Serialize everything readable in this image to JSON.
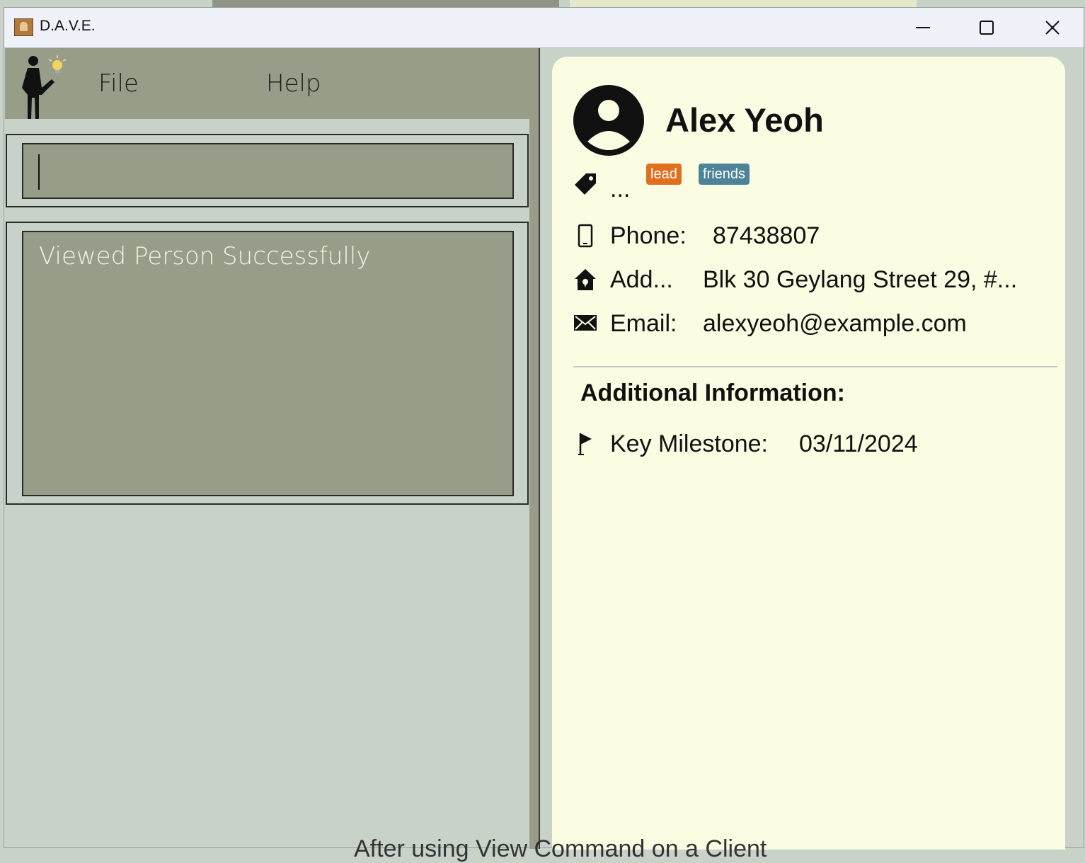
{
  "window": {
    "title": "D.A.V.E.",
    "minimize_icon": "minimize-icon",
    "maximize_icon": "maximize-icon",
    "close_icon": "close-icon"
  },
  "menu": {
    "items": [
      {
        "label": "File"
      },
      {
        "label": "Help"
      }
    ]
  },
  "command": {
    "value": ""
  },
  "result": {
    "message": "Viewed Person Successfully"
  },
  "person": {
    "name": "Alex Yeoh",
    "tags_label": "...",
    "tags": [
      {
        "label": "lead",
        "color": "#e07020"
      },
      {
        "label": "friends",
        "color": "#4d8399"
      }
    ],
    "phone_label": "Phone:",
    "phone": "87438807",
    "address_label": "Add...",
    "address": "Blk 30 Geylang Street 29, #...",
    "email_label": "Email:",
    "email": "alexyeoh@example.com"
  },
  "additional": {
    "title": "Additional Information:",
    "milestone_label": "Key Milestone:",
    "milestone": "03/11/2024"
  },
  "caption": "After using View Command on a Client",
  "colors": {
    "accent_panel": "#989d89",
    "background": "#c9d2c9",
    "card": "#fafde2"
  }
}
